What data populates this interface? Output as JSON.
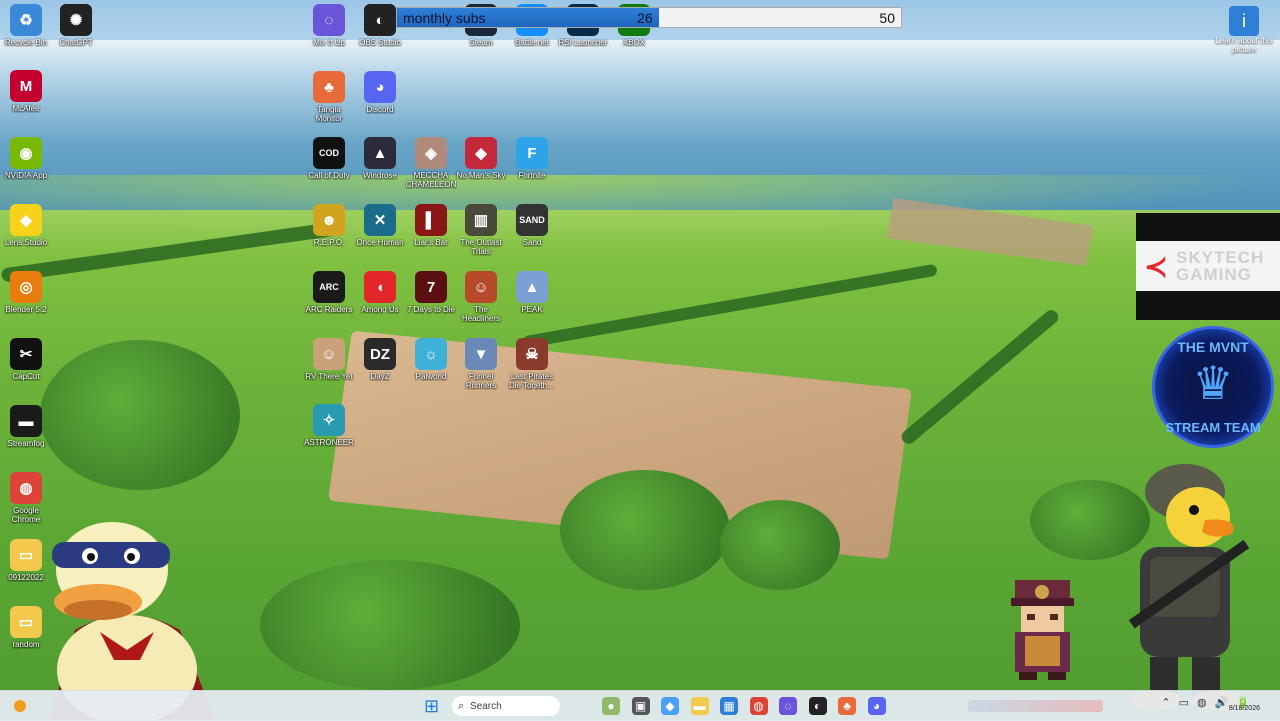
{
  "progress_overlay": {
    "title": "monthly subs",
    "current": "26",
    "goal": "50",
    "fraction": 0.52
  },
  "desktop_icons": [
    {
      "name": "recycle-bin",
      "label": "Recycle Bin",
      "glyph": "♻",
      "color": "#3a89d6"
    },
    {
      "name": "chatgpt",
      "label": "ChatGPT",
      "glyph": "✺",
      "color": "#222"
    },
    {
      "name": "mcafee",
      "label": "McAfee",
      "glyph": "M",
      "color": "#c3002f"
    },
    {
      "name": "nvidia-app",
      "label": "NVIDIA App",
      "glyph": "◉",
      "color": "#76b900"
    },
    {
      "name": "lens-studio",
      "label": "Lens Studio",
      "glyph": "◆",
      "color": "#f7d21a"
    },
    {
      "name": "blender",
      "label": "Blender 5.2",
      "glyph": "◎",
      "color": "#e87d0d"
    },
    {
      "name": "capcut",
      "label": "CapCut",
      "glyph": "✂",
      "color": "#111"
    },
    {
      "name": "streamfog",
      "label": "Streamfog",
      "glyph": "▬",
      "color": "#1b1b1b"
    },
    {
      "name": "google-chrome",
      "label": "Google Chrome",
      "glyph": "◍",
      "color": "#db4437"
    },
    {
      "name": "folder-09122022",
      "label": "09122022",
      "glyph": "▭",
      "color": "#f2c94c"
    },
    {
      "name": "folder-random",
      "label": "random",
      "glyph": "▭",
      "color": "#f2c94c"
    },
    {
      "name": "mix-it-up",
      "label": "Mix It Up",
      "glyph": "◌",
      "color": "#6a55d9"
    },
    {
      "name": "obs-studio",
      "label": "OBS Studio",
      "glyph": "◐",
      "color": "#222"
    },
    {
      "name": "steam",
      "label": "Steam",
      "glyph": "◈",
      "color": "#1b2838"
    },
    {
      "name": "battlenet",
      "label": "Battle.net",
      "glyph": "✦",
      "color": "#148eff"
    },
    {
      "name": "rsi-launcher",
      "label": "RSI Launcher",
      "glyph": "▣",
      "color": "#0a2a4a"
    },
    {
      "name": "xbox",
      "label": "XBOX",
      "glyph": "✕",
      "color": "#107c10"
    },
    {
      "name": "tangia",
      "label": "Tangia Monitor",
      "glyph": "♣",
      "color": "#e86a3a"
    },
    {
      "name": "discord",
      "label": "Discord",
      "glyph": "◕",
      "color": "#5865f2"
    },
    {
      "name": "call-of-duty",
      "label": "Call of Duty",
      "glyph": "COD",
      "color": "#111"
    },
    {
      "name": "windrose",
      "label": "Windrose",
      "glyph": "▲",
      "color": "#2b2b3a"
    },
    {
      "name": "mecha-chameleon",
      "label": "MECCHA CHAMELEON",
      "glyph": "◈",
      "color": "#b08a7a"
    },
    {
      "name": "no-mans-sky",
      "label": "No Man's Sky",
      "glyph": "◆",
      "color": "#c4283b"
    },
    {
      "name": "fortnite",
      "label": "Fortnite",
      "glyph": "F",
      "color": "#2ea4e8"
    },
    {
      "name": "repo",
      "label": "R.E.P.O.",
      "glyph": "☻",
      "color": "#d0a41e"
    },
    {
      "name": "once-human",
      "label": "Once Human",
      "glyph": "✕",
      "color": "#1b6c8a"
    },
    {
      "name": "liars-bar",
      "label": "Liar's Bar",
      "glyph": "▌",
      "color": "#8a1616"
    },
    {
      "name": "the-outlast-trials",
      "label": "The Outlast Trials",
      "glyph": "▥",
      "color": "#4a4a3a"
    },
    {
      "name": "sand",
      "label": "Sand",
      "glyph": "SAND",
      "color": "#333"
    },
    {
      "name": "arc-raiders",
      "label": "ARC Raiders",
      "glyph": "ARC",
      "color": "#1a1a1a"
    },
    {
      "name": "among-us",
      "label": "Among Us",
      "glyph": "◖",
      "color": "#e3262a"
    },
    {
      "name": "7-days-to-die",
      "label": "7 Days to Die",
      "glyph": "7",
      "color": "#5a1010"
    },
    {
      "name": "the-headliners",
      "label": "The Headliners",
      "glyph": "☺",
      "color": "#b64a2a"
    },
    {
      "name": "peak",
      "label": "PEAK",
      "glyph": "▲",
      "color": "#7aa0d4"
    },
    {
      "name": "rv-there-yet",
      "label": "RV There Yet",
      "glyph": "☺",
      "color": "#c9a27a"
    },
    {
      "name": "dayz",
      "label": "DayZ",
      "glyph": "DZ",
      "color": "#2a2a2a"
    },
    {
      "name": "palworld",
      "label": "Palworld",
      "glyph": "☼",
      "color": "#3fb0d8"
    },
    {
      "name": "funnel-runners",
      "label": "Funnel Runners",
      "glyph": "▼",
      "color": "#6a88b8"
    },
    {
      "name": "last-pirates",
      "label": "Last Pirates Die Togeth…",
      "glyph": "☠",
      "color": "#8a3a2a"
    },
    {
      "name": "astroneer",
      "label": "ASTRONEER",
      "glyph": "✧",
      "color": "#2a9ab0"
    }
  ],
  "info_icon": {
    "label": "Learn about this picture",
    "glyph": "i"
  },
  "skytech": {
    "line1": "SKYTECH",
    "line2": "GAMING",
    "logo": "≺"
  },
  "mvnt": {
    "top": "THE MVNT",
    "bottom": "STREAM TEAM",
    "crown": "♛"
  },
  "taskbar": {
    "search_placeholder": "Search",
    "clock_date": "8/18/2026",
    "apps": [
      {
        "name": "widgets-icon",
        "glyph": "●",
        "color": "#8fb86a"
      },
      {
        "name": "task-view-icon",
        "glyph": "▣",
        "color": "#555"
      },
      {
        "name": "copilot-icon",
        "glyph": "◆",
        "color": "#4aa0ff"
      },
      {
        "name": "file-explorer-icon",
        "glyph": "▬",
        "color": "#f2c94c"
      },
      {
        "name": "store-icon",
        "glyph": "▦",
        "color": "#2f7fd6"
      },
      {
        "name": "chrome-icon",
        "glyph": "◍",
        "color": "#db4437"
      },
      {
        "name": "mixitup-taskbar-icon",
        "glyph": "◌",
        "color": "#6a55d9"
      },
      {
        "name": "obs-taskbar-icon",
        "glyph": "◐",
        "color": "#222"
      },
      {
        "name": "tangia-taskbar-icon",
        "glyph": "♣",
        "color": "#e86a3a"
      },
      {
        "name": "discord-taskbar-icon",
        "glyph": "◕",
        "color": "#5865f2"
      }
    ],
    "tray": [
      "⌃",
      "▭",
      "◍",
      "🔊",
      "🔋"
    ]
  }
}
